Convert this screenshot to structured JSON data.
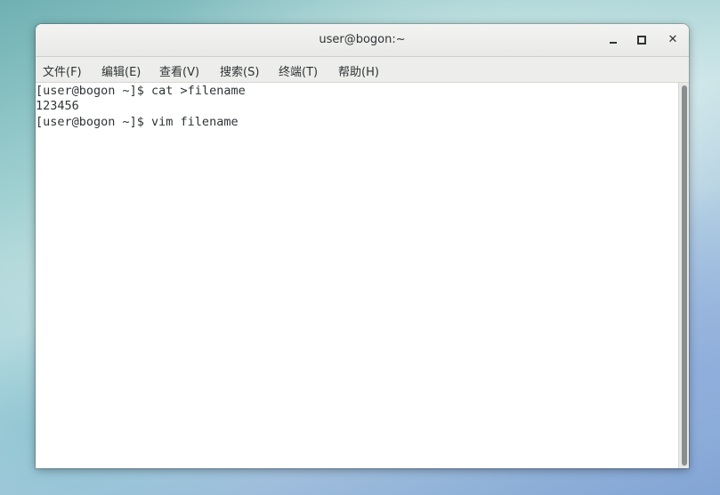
{
  "window": {
    "title": "user@bogon:~"
  },
  "menu": {
    "items": [
      {
        "label": "文件(F)"
      },
      {
        "label": "编辑(E)"
      },
      {
        "label": "查看(V)"
      },
      {
        "label": "搜索(S)"
      },
      {
        "label": "终端(T)"
      },
      {
        "label": "帮助(H)"
      }
    ]
  },
  "terminal": {
    "lines": [
      {
        "text": "[user@bogon ~]$ cat >filename"
      },
      {
        "text": "123456"
      },
      {
        "text": "[user@bogon ~]$ vim filename"
      }
    ]
  }
}
